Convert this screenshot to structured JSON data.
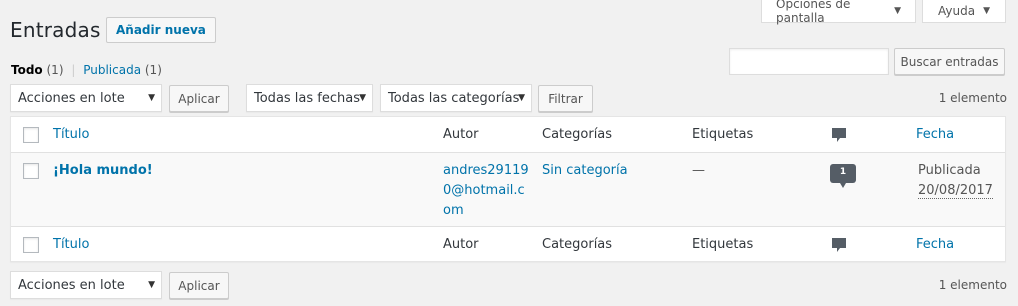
{
  "screen_meta": {
    "options_label": "Opciones de pantalla",
    "help_label": "Ayuda"
  },
  "header": {
    "title": "Entradas",
    "add_new": "Añadir nueva"
  },
  "views": [
    {
      "label": "Todo",
      "count": "(1)"
    },
    {
      "label": "Publicada",
      "count": "(1)"
    }
  ],
  "views_separator": "|",
  "search": {
    "value": "",
    "button": "Buscar entradas"
  },
  "tablenav_top": {
    "bulk_select": "Acciones en lote",
    "apply": "Aplicar",
    "date_filter": "Todas las fechas",
    "category_filter": "Todas las categorías",
    "filter_button": "Filtrar",
    "items": "1 elemento"
  },
  "tablenav_bottom": {
    "bulk_select": "Acciones en lote",
    "apply": "Aplicar",
    "items": "1 elemento"
  },
  "columns": {
    "title": "Título",
    "author": "Autor",
    "categories": "Categorías",
    "tags": "Etiquetas",
    "comments_icon": "comment-bubble-icon",
    "date": "Fecha"
  },
  "rows": [
    {
      "title": "¡Hola mundo!",
      "author_line1": "andres29119",
      "author_line2": "0@hotmail.c",
      "author_line3": "om",
      "category": "Sin categoría",
      "tags": "—",
      "comments": "1",
      "status": "Publicada",
      "date": "20/08/2017"
    }
  ],
  "colors": {
    "link": "#0073aa",
    "bubble": "#72777c",
    "bubble_dark": "#555d66"
  }
}
